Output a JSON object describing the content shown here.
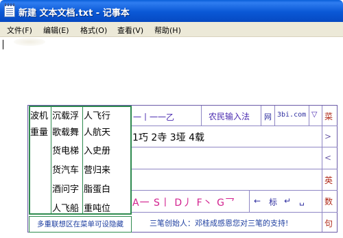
{
  "window": {
    "title": "新建 文本文档.txt - 记事本"
  },
  "menu": [
    "文件(F)",
    "编辑(E)",
    "格式(O)",
    "查看(V)",
    "帮助(H)"
  ],
  "editor": {
    "text": ""
  },
  "ime": {
    "candidates": {
      "col1": [
        "波机",
        "重量"
      ],
      "col2": [
        "沉载浮",
        "歌载舞",
        "货电梯",
        "货汽车",
        "酒问字",
        "人飞船"
      ],
      "col3": [
        "人飞行",
        "人航天",
        "入史册",
        "营归来",
        "脂蛋白",
        "重吨位"
      ]
    },
    "hint": "多重联想区在菜单可设隐藏",
    "code_row": "一丨一一乙",
    "name": "农民输入法",
    "status_net": "网",
    "status_site": "3bi.com",
    "menu_arrow": "▽",
    "side_labels": [
      "菜",
      ">",
      "<",
      "英",
      "数",
      "句"
    ],
    "result": "1巧 2寺 3垭 4载",
    "strokes": "A一 S丨 D丿 F丶 G乛",
    "tools": {
      "back": "←",
      "biao": "标",
      "enter": "↵",
      "space": "␣"
    },
    "founder": "三笔创始人：邓桂成感恩您对三笔的支持!"
  }
}
